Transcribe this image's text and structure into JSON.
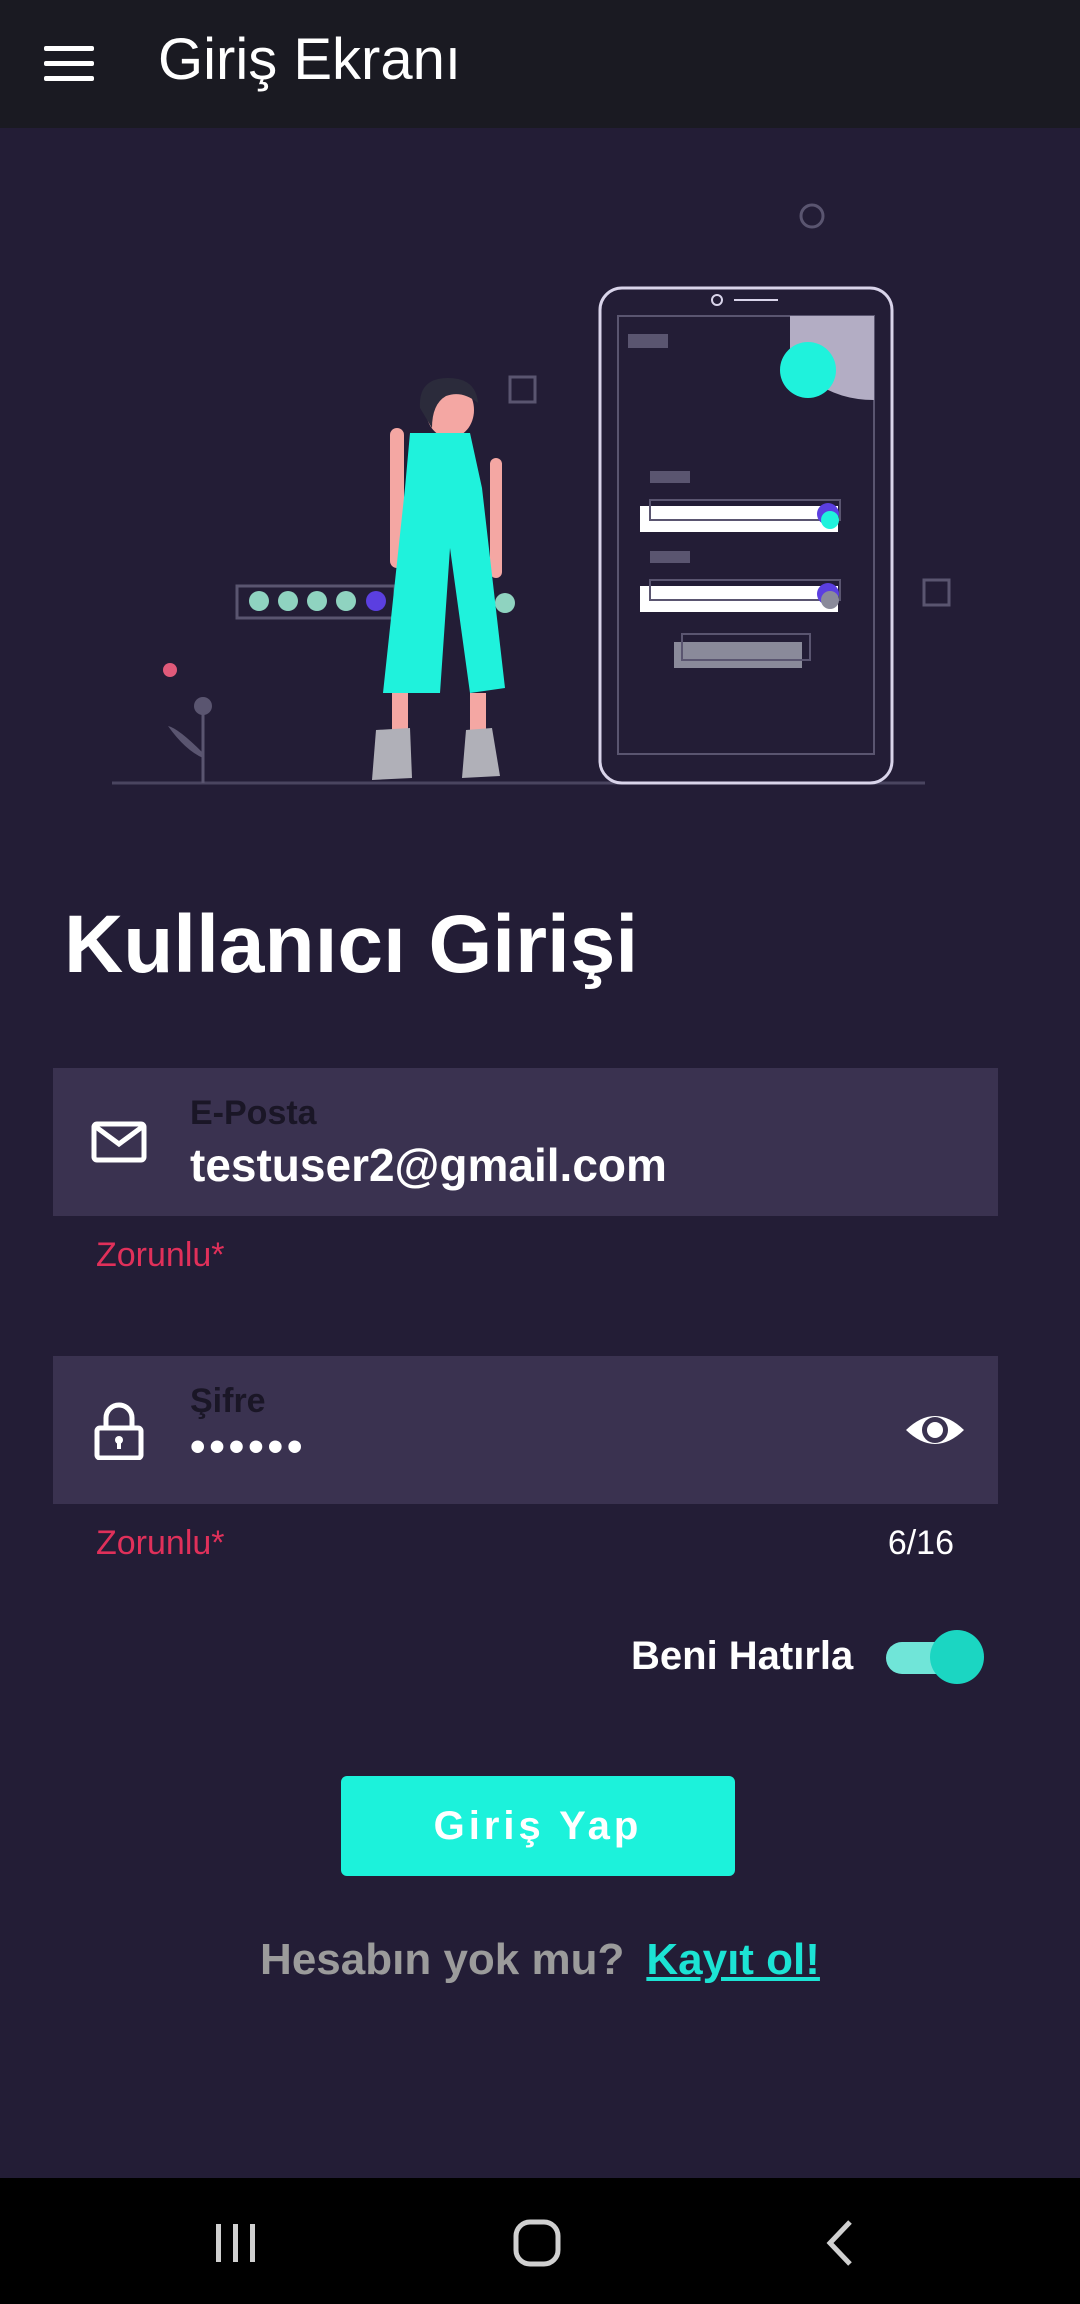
{
  "app_bar": {
    "title": "Giriş Ekranı",
    "menu_icon": "hamburger-menu-icon"
  },
  "illustration": {
    "description_icon": "login-illustration"
  },
  "login": {
    "title": "Kullanıcı Girişi",
    "email": {
      "label": "E-Posta",
      "value": "testuser2@gmail.com",
      "helper": "Zorunlu*",
      "icon": "mail-icon"
    },
    "password": {
      "label": "Şifre",
      "value": "••••••",
      "helper": "Zorunlu*",
      "counter": "6/16",
      "icon": "lock-icon",
      "toggle_icon": "eye-icon"
    },
    "remember_me": {
      "label": "Beni Hatırla",
      "checked": true
    },
    "submit_label": "Giriş Yap",
    "signup_question": "Hesabın yok mu?",
    "signup_link": "Kayıt ol!"
  },
  "colors": {
    "background": "#231d36",
    "app_bar": "#1a1a22",
    "field": "#3a3250",
    "accent": "#1cf2db",
    "error": "#e0305a"
  },
  "nav_bar": {
    "buttons": [
      "recent-apps-icon",
      "home-icon",
      "back-icon"
    ]
  }
}
